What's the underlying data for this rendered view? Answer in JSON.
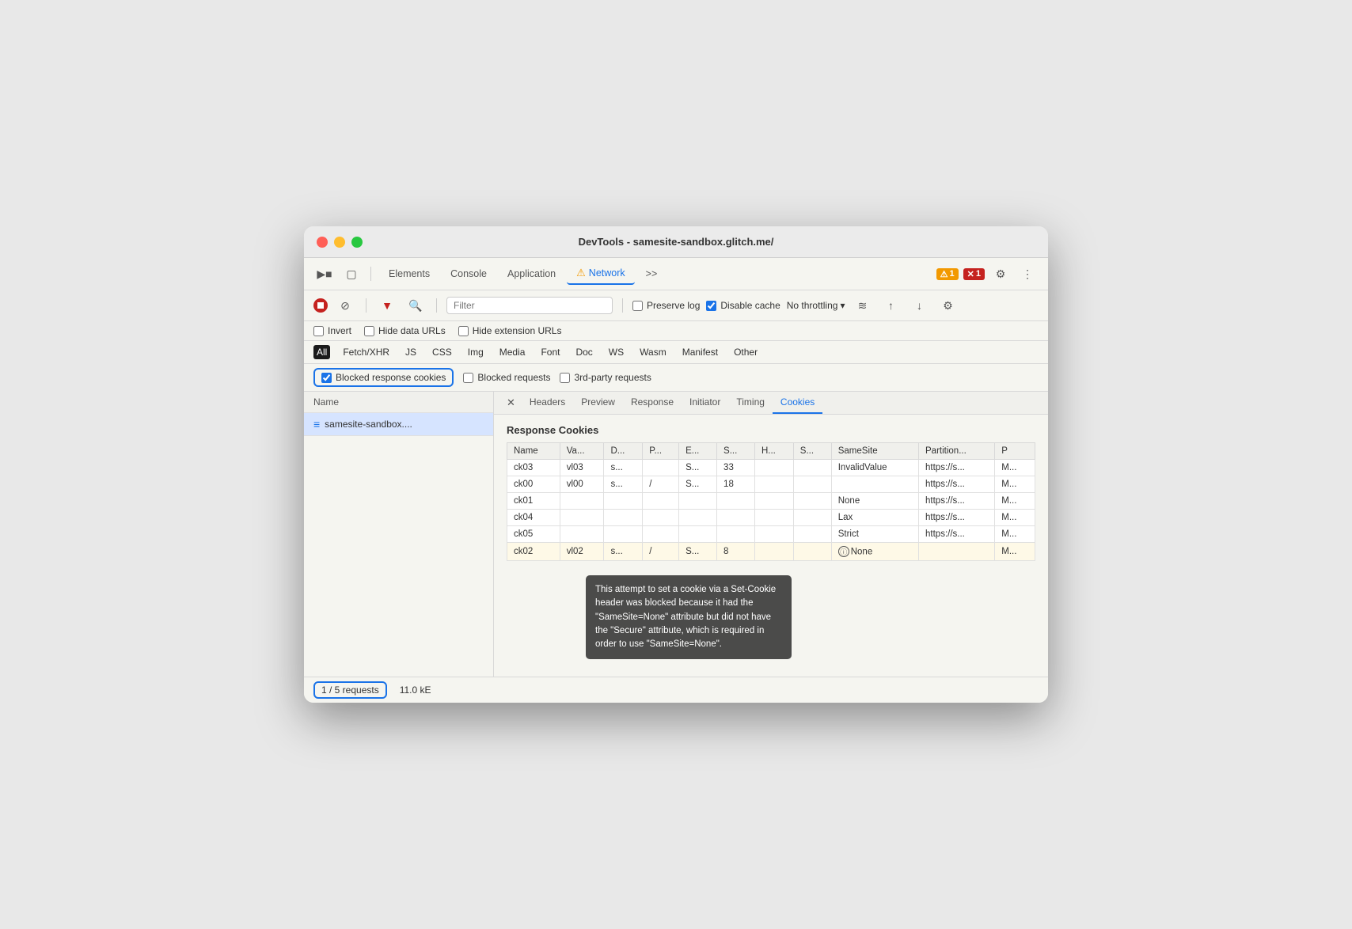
{
  "window": {
    "title": "DevTools - samesite-sandbox.glitch.me/"
  },
  "tabs": {
    "items": [
      "Elements",
      "Console",
      "Application",
      "Network"
    ],
    "active": "Network",
    "active_index": 3,
    "more": ">>"
  },
  "badges": {
    "warning_count": "1",
    "error_count": "1"
  },
  "toolbar2": {
    "filter_placeholder": "Filter",
    "preserve_log": "Preserve log",
    "disable_cache": "Disable cache",
    "no_throttling": "No throttling"
  },
  "filter_bar": {
    "invert": "Invert",
    "hide_data_urls": "Hide data URLs",
    "hide_extension_urls": "Hide extension URLs"
  },
  "type_bar": {
    "items": [
      "All",
      "Fetch/XHR",
      "JS",
      "CSS",
      "Img",
      "Media",
      "Font",
      "Doc",
      "WS",
      "Wasm",
      "Manifest",
      "Other"
    ],
    "active": "All"
  },
  "filter_row2": {
    "blocked_response_cookies": "Blocked response cookies",
    "blocked_requests": "Blocked requests",
    "third_party_requests": "3rd-party requests"
  },
  "left_pane": {
    "column_name": "Name",
    "item": "samesite-sandbox...."
  },
  "panel_tabs": {
    "headers": "Headers",
    "preview": "Preview",
    "response": "Response",
    "initiator": "Initiator",
    "timing": "Timing",
    "cookies": "Cookies",
    "active": "Cookies"
  },
  "response_cookies": {
    "title": "Response Cookies",
    "columns": [
      "Name",
      "Va...",
      "D...",
      "P...",
      "E...",
      "S...",
      "H...",
      "S...",
      "SameSite",
      "Partition...",
      "P"
    ],
    "rows": [
      {
        "name": "ck03",
        "value": "vl03",
        "domain": "s...",
        "path": "",
        "expires": "S...",
        "size": "33",
        "http": "",
        "secure": "",
        "samesite": "InvalidValue",
        "partition": "https://s...",
        "priority": "M...",
        "highlighted": false
      },
      {
        "name": "ck00",
        "value": "vl00",
        "domain": "s...",
        "path": "/",
        "expires": "S...",
        "size": "18",
        "http": "",
        "secure": "",
        "samesite": "",
        "partition": "https://s...",
        "priority": "M...",
        "highlighted": false
      },
      {
        "name": "ck01",
        "value": "",
        "domain": "",
        "path": "",
        "expires": "",
        "size": "",
        "http": "",
        "secure": "",
        "samesite": "None",
        "partition": "https://s...",
        "priority": "M...",
        "highlighted": false
      },
      {
        "name": "ck04",
        "value": "",
        "domain": "",
        "path": "",
        "expires": "",
        "size": "",
        "http": "",
        "secure": "",
        "samesite": "Lax",
        "partition": "https://s...",
        "priority": "M...",
        "highlighted": false
      },
      {
        "name": "ck05",
        "value": "",
        "domain": "",
        "path": "",
        "expires": "",
        "size": "",
        "http": "",
        "secure": "",
        "samesite": "Strict",
        "partition": "https://s...",
        "priority": "M...",
        "highlighted": false
      },
      {
        "name": "ck02",
        "value": "vl02",
        "domain": "s...",
        "path": "/",
        "expires": "S...",
        "size": "8",
        "http": "",
        "secure": "",
        "samesite": "⊙ None",
        "partition": "",
        "priority": "M...",
        "highlighted": true
      }
    ]
  },
  "tooltip": {
    "text": "This attempt to set a cookie via a Set-Cookie header was blocked because it had the \"SameSite=None\" attribute but did not have the \"Secure\" attribute, which is required in order to use \"SameSite=None\"."
  },
  "status_bar": {
    "requests": "1 / 5 requests",
    "size": "11.0 kE"
  }
}
